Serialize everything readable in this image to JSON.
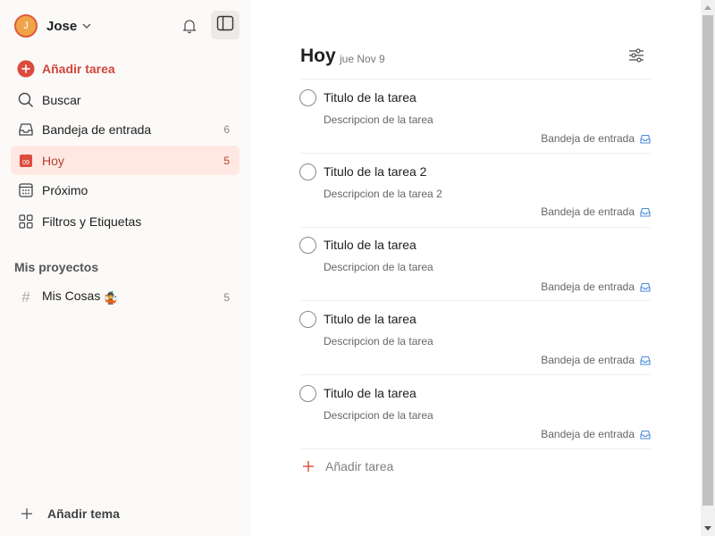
{
  "sidebar": {
    "user": {
      "initial": "J",
      "name": "Jose"
    },
    "add_task_label": "Añadir tarea",
    "nav": [
      {
        "key": "search",
        "label": "Buscar",
        "count": ""
      },
      {
        "key": "inbox",
        "label": "Bandeja de entrada",
        "count": "6"
      },
      {
        "key": "today",
        "label": "Hoy",
        "count": "5",
        "icon_text": "09",
        "active": true
      },
      {
        "key": "upcoming",
        "label": "Próximo",
        "count": ""
      },
      {
        "key": "filters",
        "label": "Filtros y Etiquetas",
        "count": ""
      }
    ],
    "projects_title": "Mis proyectos",
    "projects": [
      {
        "hash": "#",
        "label": "Mis Cosas",
        "count": "5",
        "emoji": "🤹"
      }
    ],
    "add_team_label": "Añadir tema"
  },
  "main": {
    "title": "Hoy",
    "date": "jue Nov 9",
    "tasks": [
      {
        "title": "Titulo de la tarea",
        "description": "Descripcion de la tarea",
        "project": "Bandeja de entrada"
      },
      {
        "title": "Titulo de la tarea 2",
        "description": "Descripcion de la tarea 2",
        "project": "Bandeja de entrada"
      },
      {
        "title": "Titulo de la tarea",
        "description": "Descripcion de la tarea",
        "project": "Bandeja de entrada"
      },
      {
        "title": "Titulo de la tarea",
        "description": "Descripcion de la tarea",
        "project": "Bandeja de entrada"
      },
      {
        "title": "Titulo de la tarea",
        "description": "Descripcion de la tarea",
        "project": "Bandeja de entrada"
      }
    ],
    "add_task_label": "Añadir tarea"
  },
  "colors": {
    "accent": "#dc4c3e",
    "active_bg": "#ffe8e1",
    "sidebar_bg": "#fcfaf8",
    "inbox_icon": "#4a8ad9"
  },
  "icons": [
    "chevron-down-icon",
    "bell-icon",
    "sidebar-toggle-icon",
    "plus-circle-icon",
    "search-icon",
    "inbox-icon",
    "calendar-today-icon",
    "calendar-grid-icon",
    "filters-icon",
    "hash-icon",
    "plus-icon",
    "settings-sliders-icon"
  ]
}
